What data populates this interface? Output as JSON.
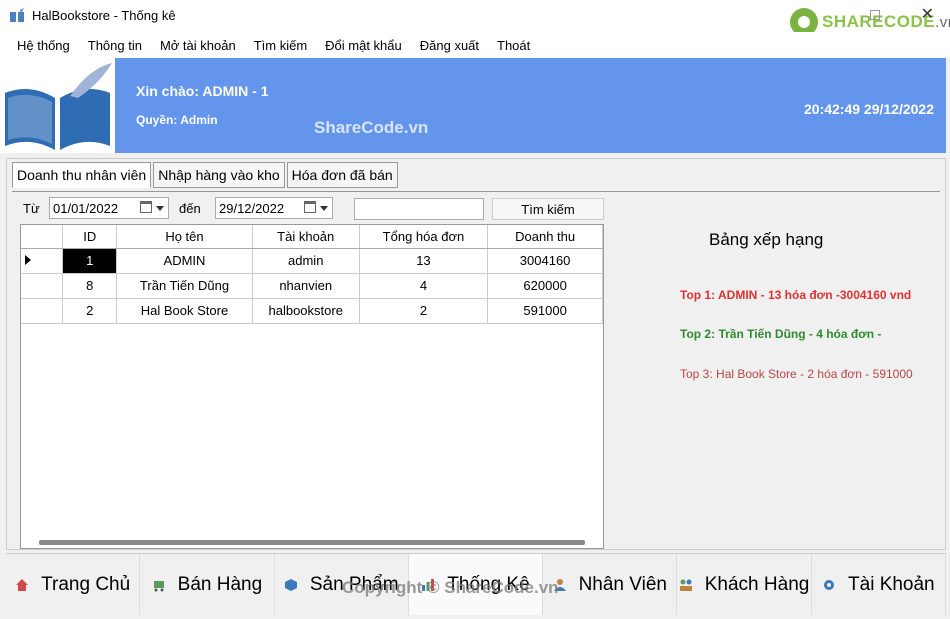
{
  "window": {
    "title": "HalBookstore - Thống kê",
    "close_label": "✕"
  },
  "watermark": {
    "brand": "SHARECODE",
    "brand_suffix": ".vn",
    "mid": "ShareCode.vn",
    "bottom": "Copyright © ShareCode.vn"
  },
  "menu": [
    "Hệ thống",
    "Thông tin",
    "Mở tài khoản",
    "Tìm kiếm",
    "Đổi mật khẩu",
    "Đăng xuất",
    "Thoát"
  ],
  "header": {
    "greeting": "Xin chào: ADMIN - 1",
    "role": "Quyền: Admin",
    "datetime": "20:42:49 29/12/2022",
    "color": "#6495ed"
  },
  "tabs": [
    "Doanh thu nhân viên",
    "Nhập hàng vào kho",
    "Hóa đơn đã bán"
  ],
  "filter": {
    "from_label": "Từ",
    "from_date": "01/01/2022",
    "to_label": "đến",
    "to_date": "29/12/2022",
    "search_value": "",
    "search_button": "Tìm kiếm"
  },
  "table": {
    "columns": [
      "ID",
      "Họ tên",
      "Tài khoản",
      "Tổng hóa đơn",
      "Doanh thu"
    ],
    "rows": [
      [
        "1",
        "ADMIN",
        "admin",
        "13",
        "3004160"
      ],
      [
        "8",
        "Trần Tiến Dũng",
        "nhanvien",
        "4",
        "620000"
      ],
      [
        "2",
        "Hal Book Store",
        "halbookstore",
        "2",
        "591000"
      ]
    ]
  },
  "ranking": {
    "title": "Bảng xếp hạng",
    "top1": "Top 1: ADMIN - 13 hóa đơn -3004160 vnd",
    "top2": "Top 2: Trần Tiến Dũng - 4 hóa đơn -",
    "top3": "Top 3: Hal Book Store - 2 hóa đơn - 591000"
  },
  "nav": [
    {
      "label": "Trang Chủ",
      "icon": "home-icon"
    },
    {
      "label": "Bán Hàng",
      "icon": "cart-icon"
    },
    {
      "label": "Sản Phẩm",
      "icon": "box-icon"
    },
    {
      "label": "Thống Kê",
      "icon": "chart-icon"
    },
    {
      "label": "Nhân Viên",
      "icon": "user-icon"
    },
    {
      "label": "Khách Hàng",
      "icon": "users-icon"
    },
    {
      "label": "Tài Khoản",
      "icon": "gear-icon"
    }
  ]
}
